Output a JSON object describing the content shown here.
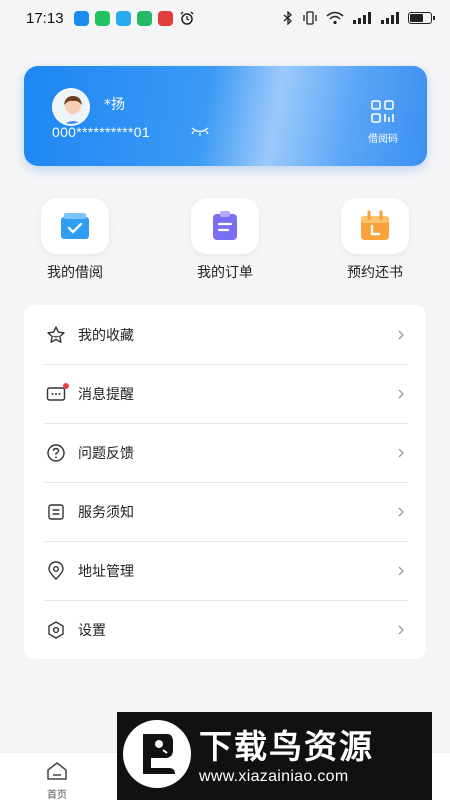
{
  "status_bar": {
    "time": "17:13",
    "network": "4G"
  },
  "profile": {
    "name": "*扬",
    "card_number": "000**********01",
    "qr_label": "借阅码"
  },
  "quick_actions": [
    {
      "label": "我的借阅",
      "icon": "book-check-icon",
      "color": "#2f9df3"
    },
    {
      "label": "我的订单",
      "icon": "clipboard-icon",
      "color": "#7a6ef2"
    },
    {
      "label": "预约还书",
      "icon": "calendar-icon",
      "color": "#f7a23a"
    }
  ],
  "menu": [
    {
      "label": "我的收藏",
      "icon": "star-icon"
    },
    {
      "label": "消息提醒",
      "icon": "message-icon",
      "badge": true
    },
    {
      "label": "问题反馈",
      "icon": "question-icon"
    },
    {
      "label": "服务须知",
      "icon": "notice-icon"
    },
    {
      "label": "地址管理",
      "icon": "location-icon"
    },
    {
      "label": "设置",
      "icon": "settings-icon"
    }
  ],
  "bottom_nav": [
    {
      "label": "首页",
      "icon": "home-icon"
    }
  ],
  "watermark": {
    "title": "下载鸟资源",
    "url": "www.xiazainiao.com"
  }
}
